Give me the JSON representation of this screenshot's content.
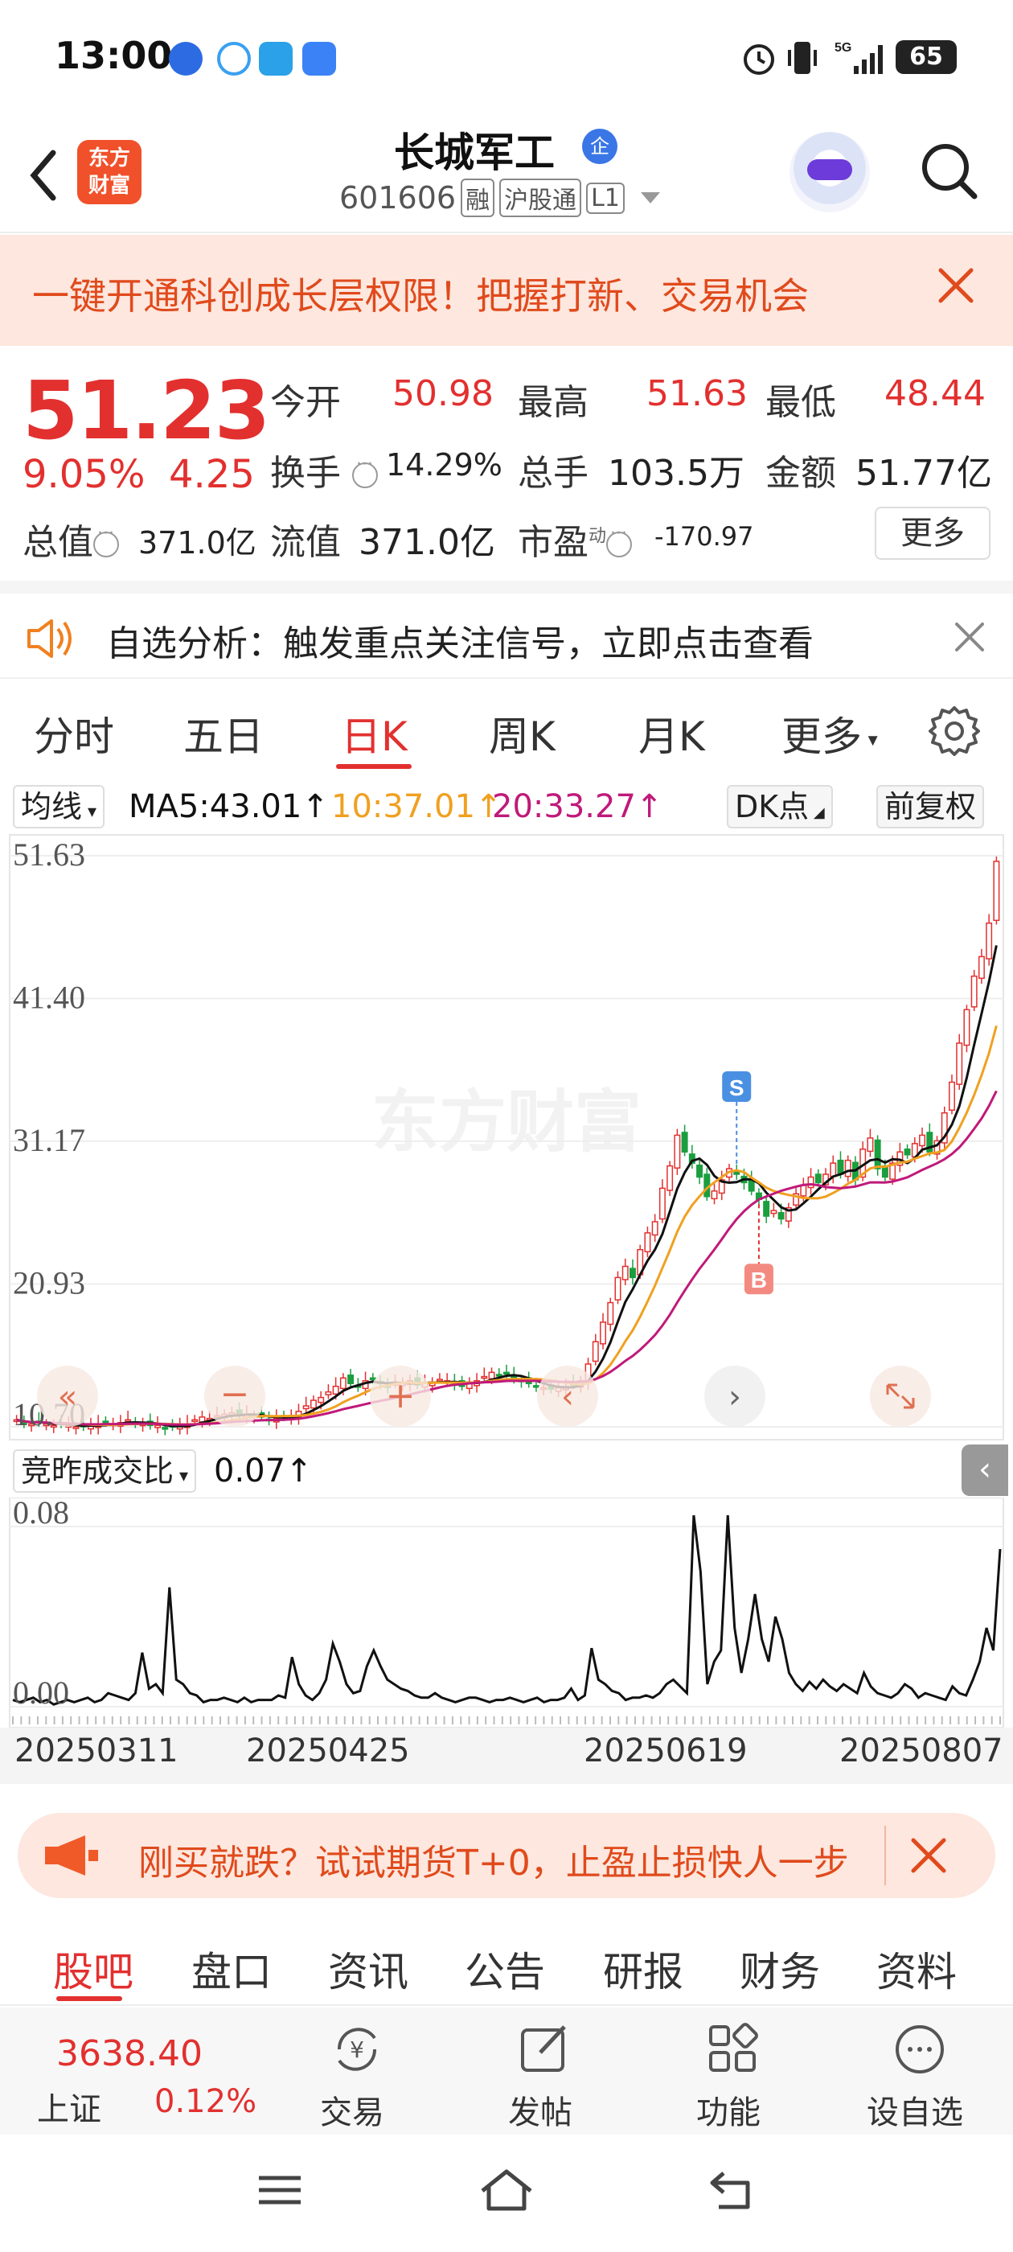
{
  "status": {
    "time": "13:00",
    "battery": "65"
  },
  "header": {
    "logo_line1": "东方",
    "logo_line2": "财富",
    "stock_name": "长城军工",
    "badge": "企",
    "code": "601606",
    "tags": [
      "融",
      "沪股通",
      "L1"
    ]
  },
  "banner": {
    "text": "一键开通科创成长层权限！把握打新、交易机会"
  },
  "quote": {
    "price": "51.23",
    "change_pct": "9.05%",
    "change": "4.25",
    "open_label": "今开",
    "open": "50.98",
    "high_label": "最高",
    "high": "51.63",
    "low_label": "最低",
    "low": "48.44",
    "turnover_label": "换手",
    "turnover": "14.29%",
    "volume_label": "总手",
    "volume": "103.5万",
    "amount_label": "金额",
    "amount": "51.77亿",
    "mktcap_label": "总值",
    "mktcap": "371.0亿",
    "float_label": "流值",
    "float": "371.0亿",
    "pe_label": "市盈",
    "pe_sup": "动",
    "pe": "-170.97",
    "more": "更多"
  },
  "analysis": {
    "text": "自选分析：触发重点关注信号，立即点击查看"
  },
  "tabs": {
    "items": [
      "分时",
      "五日",
      "日K",
      "周K",
      "月K",
      "更多"
    ],
    "active": "日K"
  },
  "ma": {
    "selector": "均线",
    "ma5": "MA5:43.01↑",
    "ma10": "10:37.01↑",
    "ma20": "20:33.27↑",
    "dk": "DK点",
    "adjust": "前复权"
  },
  "colors": {
    "up": "#e2302f",
    "down": "#1a9e3f",
    "ma5": "#111111",
    "ma10": "#f0a020",
    "ma20": "#c0197a"
  },
  "chart_data": [
    {
      "type": "candlestick",
      "y_ticks": [
        "51.63",
        "41.40",
        "31.17",
        "20.93",
        "10.70"
      ],
      "ylim": [
        10.7,
        51.63
      ],
      "watermark": "东方财富",
      "signals": [
        "S",
        "B"
      ],
      "closes": [
        11.2,
        11.0,
        10.9,
        11.0,
        10.9,
        10.8,
        10.9,
        10.8,
        10.7,
        10.7,
        10.8,
        10.9,
        11.0,
        10.9,
        11.0,
        11.2,
        11.0,
        10.9,
        10.8,
        10.8,
        10.6,
        10.7,
        10.8,
        10.9,
        11.2,
        11.4,
        11.3,
        11.5,
        11.6,
        11.7,
        11.5,
        11.6,
        11.5,
        11.4,
        11.2,
        11.3,
        11.4,
        11.5,
        11.8,
        12.2,
        12.6,
        12.8,
        13.2,
        13.6,
        14.2,
        13.8,
        13.6,
        14.0,
        14.1,
        13.8,
        13.6,
        13.8,
        13.9,
        14.0,
        13.7,
        13.8,
        13.9,
        14.1,
        14.0,
        13.8,
        13.6,
        13.8,
        14.0,
        14.3,
        14.6,
        14.4,
        14.5,
        14.2,
        14.0,
        13.8,
        13.6,
        13.5,
        13.4,
        13.5,
        13.6,
        13.7,
        14.0,
        15.2,
        16.8,
        18.2,
        19.6,
        21.4,
        22.2,
        21.4,
        23.4,
        24.6,
        25.4,
        27.8,
        29.4,
        31.6,
        30.4,
        29.6,
        28.6,
        27.2,
        27.6,
        28.4,
        29.2,
        28.8,
        28.2,
        27.6,
        27.0,
        25.8,
        26.2,
        25.6,
        26.4,
        27.4,
        28.0,
        28.6,
        28.2,
        28.8,
        29.6,
        28.8,
        29.8,
        28.4,
        30.6,
        31.4,
        29.2,
        28.6,
        29.6,
        30.4,
        30.2,
        31.0,
        31.6,
        30.4,
        31.2,
        33.2,
        35.4,
        38.2,
        40.6,
        43.0,
        44.4,
        46.8,
        51.23
      ]
    },
    {
      "type": "line",
      "indicator": "竞昨成交比",
      "indicator_value": "0.07↑",
      "y_ticks": [
        "0.08",
        "0.00"
      ],
      "ylim": [
        0,
        0.08
      ],
      "x_labels": [
        "20250311",
        "20250425",
        "20250619",
        "20250807"
      ],
      "values": [
        0.003,
        0.002,
        0.003,
        0.004,
        0.002,
        0.003,
        0.001,
        0.002,
        0.003,
        0.002,
        0.003,
        0.004,
        0.002,
        0.003,
        0.006,
        0.005,
        0.004,
        0.003,
        0.006,
        0.024,
        0.008,
        0.01,
        0.006,
        0.053,
        0.012,
        0.01,
        0.006,
        0.005,
        0.002,
        0.003,
        0.003,
        0.004,
        0.003,
        0.002,
        0.004,
        0.002,
        0.003,
        0.003,
        0.003,
        0.005,
        0.004,
        0.022,
        0.01,
        0.005,
        0.003,
        0.006,
        0.012,
        0.028,
        0.02,
        0.01,
        0.006,
        0.007,
        0.018,
        0.025,
        0.018,
        0.012,
        0.01,
        0.008,
        0.007,
        0.005,
        0.004,
        0.004,
        0.006,
        0.004,
        0.003,
        0.002,
        0.003,
        0.004,
        0.004,
        0.003,
        0.002,
        0.003,
        0.003,
        0.004,
        0.003,
        0.002,
        0.003,
        0.004,
        0.002,
        0.003,
        0.003,
        0.004,
        0.008,
        0.003,
        0.005,
        0.026,
        0.012,
        0.01,
        0.007,
        0.006,
        0.003,
        0.004,
        0.004,
        0.005,
        0.004,
        0.006,
        0.01,
        0.012,
        0.009,
        0.006,
        0.085,
        0.06,
        0.01,
        0.02,
        0.025,
        0.085,
        0.035,
        0.015,
        0.03,
        0.05,
        0.03,
        0.02,
        0.04,
        0.03,
        0.015,
        0.01,
        0.007,
        0.011,
        0.008,
        0.012,
        0.009,
        0.007,
        0.01,
        0.008,
        0.006,
        0.015,
        0.009,
        0.006,
        0.005,
        0.004,
        0.006,
        0.01,
        0.008,
        0.004,
        0.006,
        0.005,
        0.004,
        0.003,
        0.009,
        0.006,
        0.005,
        0.012,
        0.02,
        0.035,
        0.025,
        0.07
      ]
    }
  ],
  "ad": {
    "text": "刚买就跌？试试期货T+0，止盈止损快人一步"
  },
  "bottom_tabs": {
    "items": [
      "股吧",
      "盘口",
      "资讯",
      "公告",
      "研报",
      "财务",
      "资料"
    ]
  },
  "bottom_nav": {
    "index_value": "3638.40",
    "index_name": "上证",
    "index_pct": "0.12%",
    "items": [
      "交易",
      "发帖",
      "功能",
      "设自选"
    ]
  }
}
